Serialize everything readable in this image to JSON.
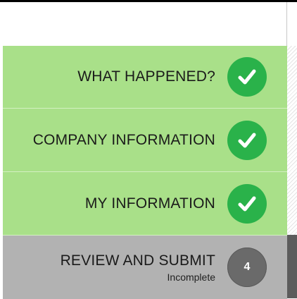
{
  "steps": [
    {
      "label": "WHAT HAPPENED?",
      "state": "complete",
      "icon": "check-icon"
    },
    {
      "label": "COMPANY INFORMATION",
      "state": "complete",
      "icon": "check-icon"
    },
    {
      "label": "MY INFORMATION",
      "state": "complete",
      "icon": "check-icon"
    },
    {
      "label": "REVIEW AND SUBMIT",
      "status": "Incomplete",
      "state": "current",
      "number": "4"
    }
  ],
  "colors": {
    "complete_bg": "#a9e089",
    "check_circle": "#2ab24a",
    "current_bg": "#b2b2b2",
    "number_circle": "#6a6a6a",
    "current_marker": "#5c5c5c"
  }
}
